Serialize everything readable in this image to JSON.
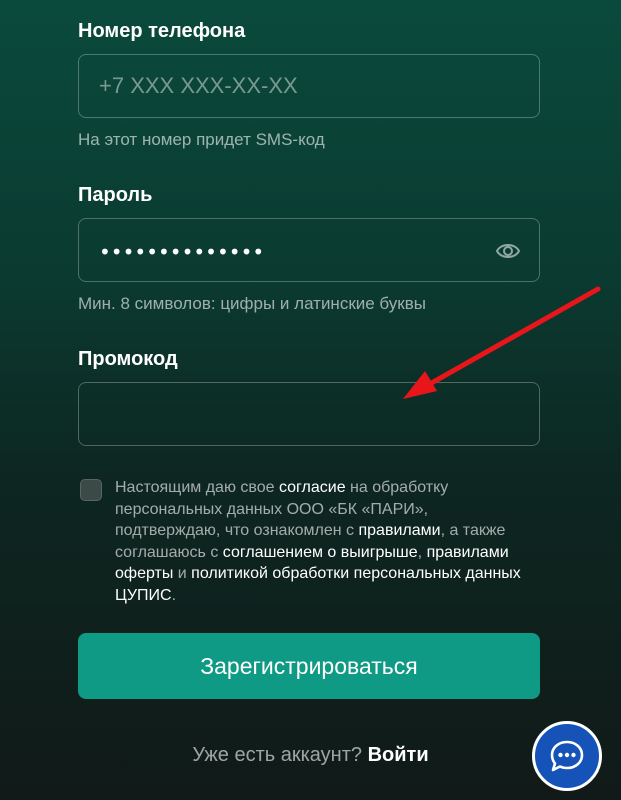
{
  "phone": {
    "label": "Номер телефона",
    "placeholder": "+7 XXX XXX-XX-XX",
    "value": "",
    "hint": "На этот номер придет SMS-код"
  },
  "password": {
    "label": "Пароль",
    "masked_value": "••••••••••••••",
    "hint": "Мин. 8 символов: цифры и латинские буквы",
    "icon": "eye-icon"
  },
  "promo": {
    "label": "Промокод",
    "value": "",
    "placeholder": ""
  },
  "consent": {
    "checked": false,
    "t1": "Настоящим даю свое ",
    "l1": "согласие",
    "t2": " на обработку персональных данных ООО «БК «ПАРИ», подтверждаю, что ознакомлен с ",
    "l2": "правилами",
    "t3": ", а также соглашаюсь с ",
    "l3": "соглашением о выигрыше",
    "t4": ", ",
    "l4": "правилами оферты",
    "t5": " и ",
    "l5": "политикой обработки персональных данных ЦУПИС",
    "t6": "."
  },
  "register_button": "Зарегистрироваться",
  "login": {
    "text": "Уже есть аккаунт?",
    "link": "Войти"
  },
  "chat": {
    "icon": "chat-icon"
  },
  "colors": {
    "accent": "#0f9a85",
    "chat": "#1553b8",
    "annotation_arrow": "#e8161b"
  }
}
